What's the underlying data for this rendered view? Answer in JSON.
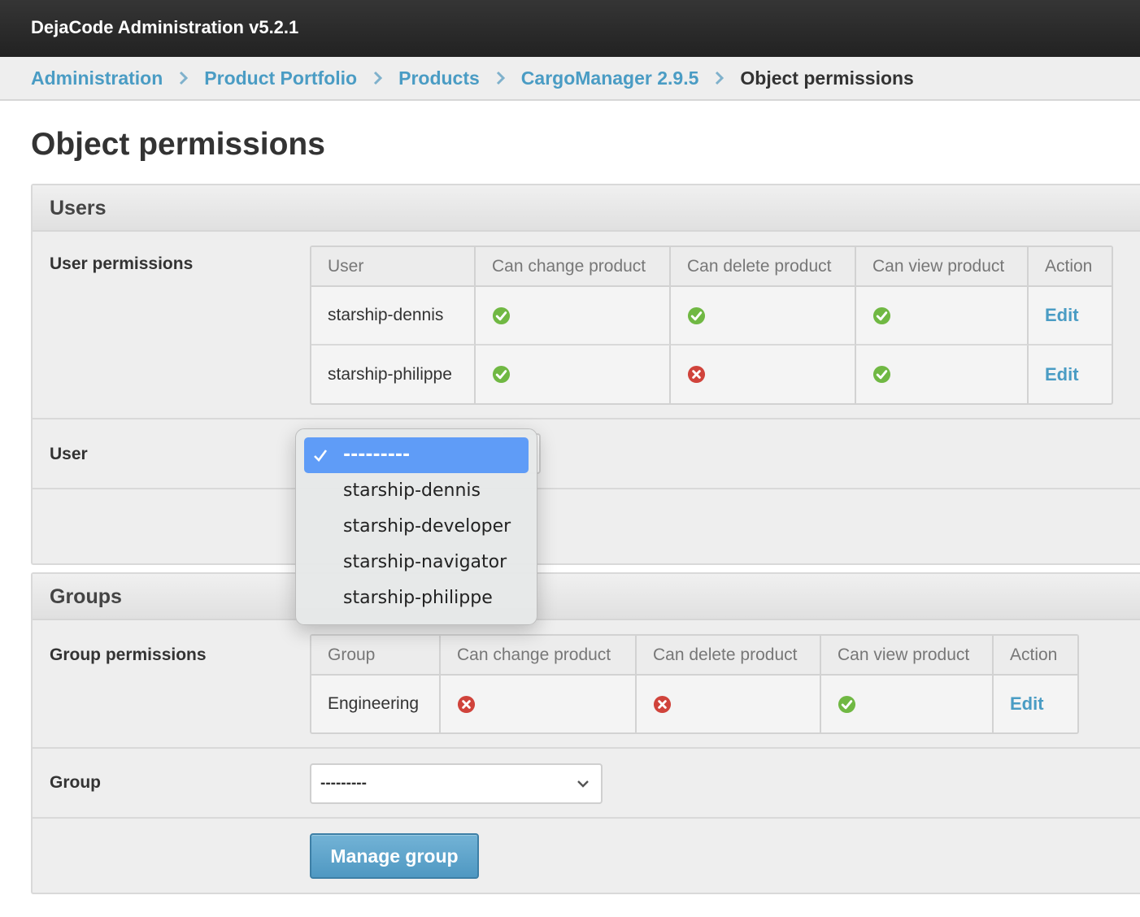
{
  "header": {
    "title": "DejaCode Administration v5.2.1"
  },
  "breadcrumb": {
    "items": [
      "Administration",
      "Product Portfolio",
      "Products",
      "CargoManager 2.9.5"
    ],
    "current": "Object permissions"
  },
  "page": {
    "title": "Object permissions"
  },
  "users": {
    "heading": "Users",
    "permissions_label": "User permissions",
    "columns": [
      "User",
      "Can change product",
      "Can delete product",
      "Can view product",
      "Action"
    ],
    "rows": [
      {
        "name": "starship-dennis",
        "change": "check",
        "delete": "check",
        "view": "check",
        "action": "Edit"
      },
      {
        "name": "starship-philippe",
        "change": "check",
        "delete": "cross",
        "view": "check",
        "action": "Edit"
      }
    ],
    "select_label": "User",
    "dropdown": {
      "selected": "---------",
      "options": [
        "starship-dennis",
        "starship-developer",
        "starship-navigator",
        "starship-philippe"
      ]
    }
  },
  "groups": {
    "heading": "Groups",
    "permissions_label": "Group permissions",
    "columns": [
      "Group",
      "Can change product",
      "Can delete product",
      "Can view product",
      "Action"
    ],
    "rows": [
      {
        "name": "Engineering",
        "change": "cross",
        "delete": "cross",
        "view": "check",
        "action": "Edit"
      }
    ],
    "select_label": "Group",
    "select_value": "---------",
    "button_label": "Manage group"
  },
  "colors": {
    "check": "#70b843",
    "cross": "#d0433b",
    "link": "#4a9cc4"
  }
}
